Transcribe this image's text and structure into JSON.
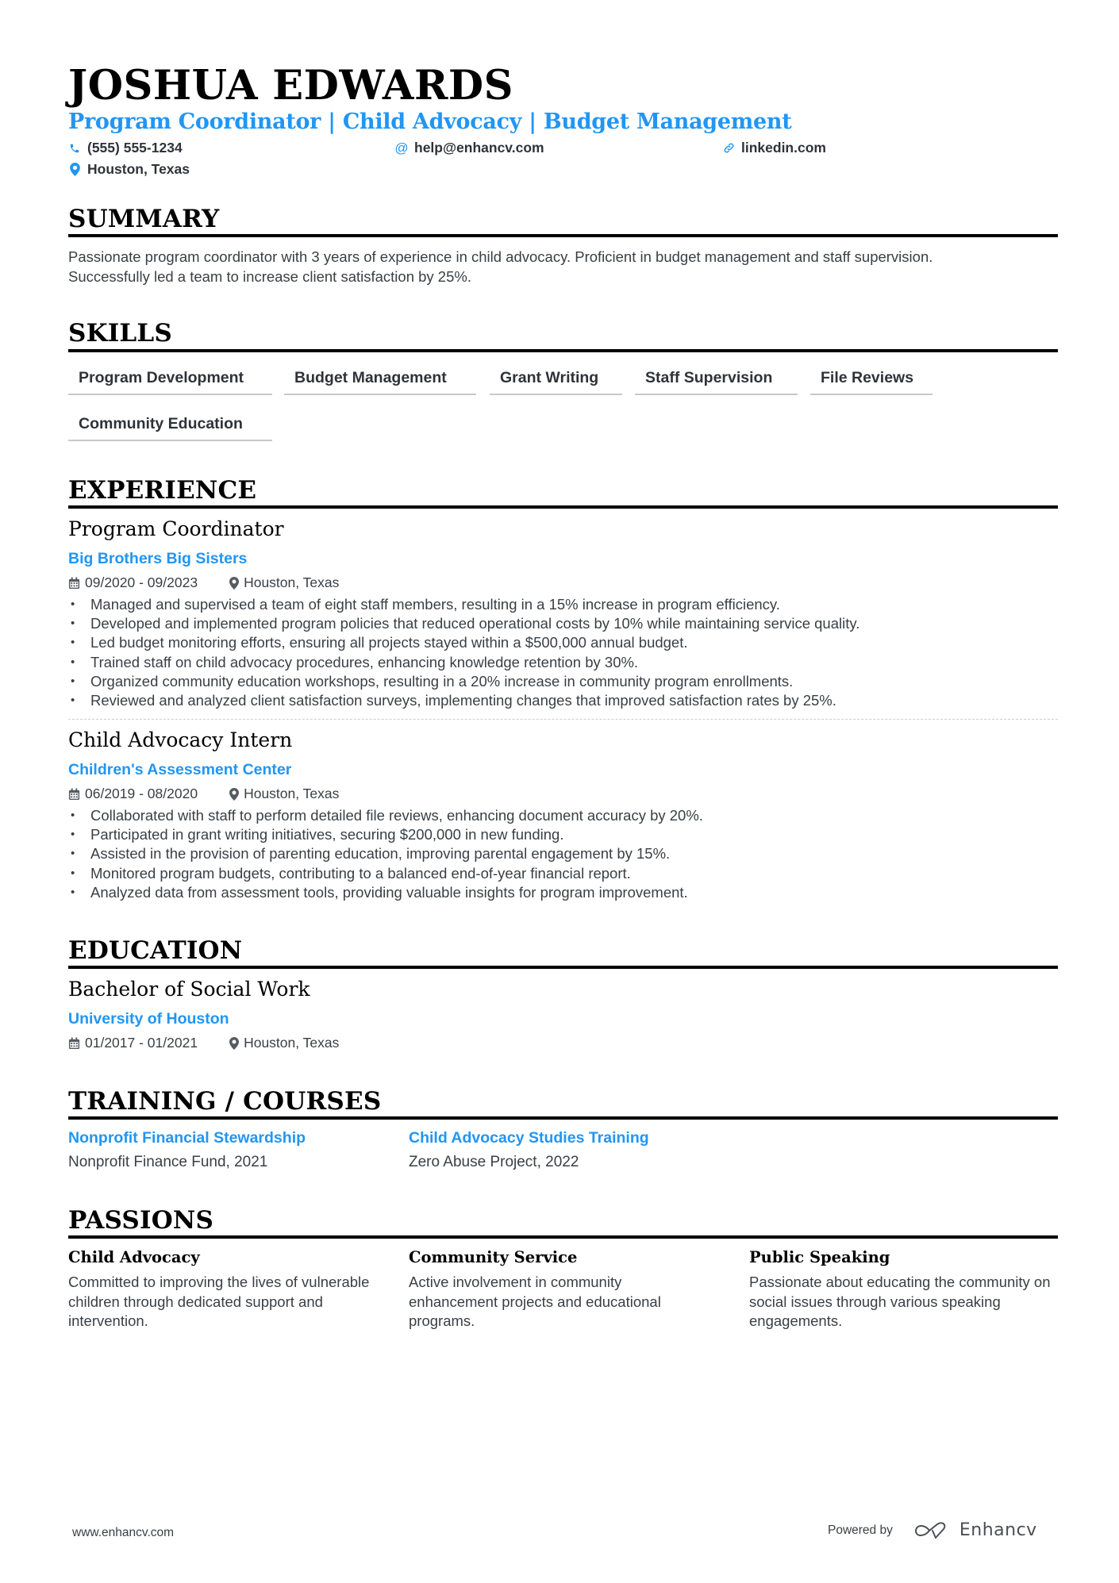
{
  "header": {
    "name": "JOSHUA EDWARDS",
    "tagline": "Program Coordinator | Child Advocacy | Budget Management",
    "contacts": {
      "phone": {
        "icon": "phone-icon",
        "value": "(555) 555-1234"
      },
      "email": {
        "icon": "at-icon",
        "value": "help@enhancv.com"
      },
      "website": {
        "icon": "link-icon",
        "value": "linkedin.com"
      },
      "location": {
        "icon": "location-pin-icon",
        "value": "Houston, Texas"
      }
    }
  },
  "summary": {
    "title": "SUMMARY",
    "text_line1": "Passionate program coordinator with 3 years of experience in child advocacy. Proficient in budget management and staff supervision.",
    "text_line2": "Successfully led a team to increase client satisfaction by 25%."
  },
  "skills": {
    "title": "SKILLS",
    "items": [
      "Program Development",
      "Budget Management",
      "Grant Writing",
      "Staff Supervision",
      "File Reviews",
      "Community Education"
    ]
  },
  "experience": {
    "title": "EXPERIENCE",
    "jobs": [
      {
        "title": "Program Coordinator",
        "company": "Big Brothers Big Sisters",
        "dates": "09/2020 - 09/2023",
        "location": "Houston, Texas",
        "bullets": [
          "Managed and supervised a team of eight staff members, resulting in a 15% increase in program efficiency.",
          "Developed and implemented program policies that reduced operational costs by 10% while maintaining service quality.",
          "Led budget monitoring efforts, ensuring all projects stayed within a $500,000 annual budget.",
          "Trained staff on child advocacy procedures, enhancing knowledge retention by 30%.",
          "Organized community education workshops, resulting in a 20% increase in community program enrollments.",
          "Reviewed and analyzed client satisfaction surveys, implementing changes that improved satisfaction rates by 25%."
        ]
      },
      {
        "title": "Child Advocacy Intern",
        "company": "Children's Assessment Center",
        "dates": "06/2019 - 08/2020",
        "location": "Houston, Texas",
        "bullets": [
          "Collaborated with staff to perform detailed file reviews, enhancing document accuracy by 20%.",
          "Participated in grant writing initiatives, securing $200,000 in new funding.",
          "Assisted in the provision of parenting education, improving parental engagement by 15%.",
          "Monitored program budgets, contributing to a balanced end-of-year financial report.",
          "Analyzed data from assessment tools, providing valuable insights for program improvement."
        ]
      }
    ]
  },
  "education": {
    "title": "EDUCATION",
    "degree": "Bachelor of Social Work",
    "school": "University of Houston",
    "dates": "01/2017 - 01/2021",
    "location": "Houston, Texas"
  },
  "training": {
    "title": "TRAINING / COURSES",
    "items": [
      {
        "title": "Nonprofit Financial Stewardship",
        "sub": "Nonprofit Finance Fund, 2021"
      },
      {
        "title": "Child Advocacy Studies Training",
        "sub": "Zero Abuse Project, 2022"
      }
    ]
  },
  "passions": {
    "title": "PASSIONS",
    "items": [
      {
        "title": "Child Advocacy",
        "desc": "Committed to improving the lives of vulnerable children through dedicated support and intervention."
      },
      {
        "title": "Community Service",
        "desc": "Active involvement in community enhancement projects and educational programs."
      },
      {
        "title": "Public Speaking",
        "desc": "Passionate about educating the community on social issues through various speaking engagements."
      }
    ]
  },
  "footer": {
    "website": "www.enhancv.com",
    "powered_by": "Powered by",
    "brand": "Enhancv"
  },
  "colors": {
    "accent": "#2196f3",
    "text": "#3a3f44",
    "heading": "#000000"
  }
}
